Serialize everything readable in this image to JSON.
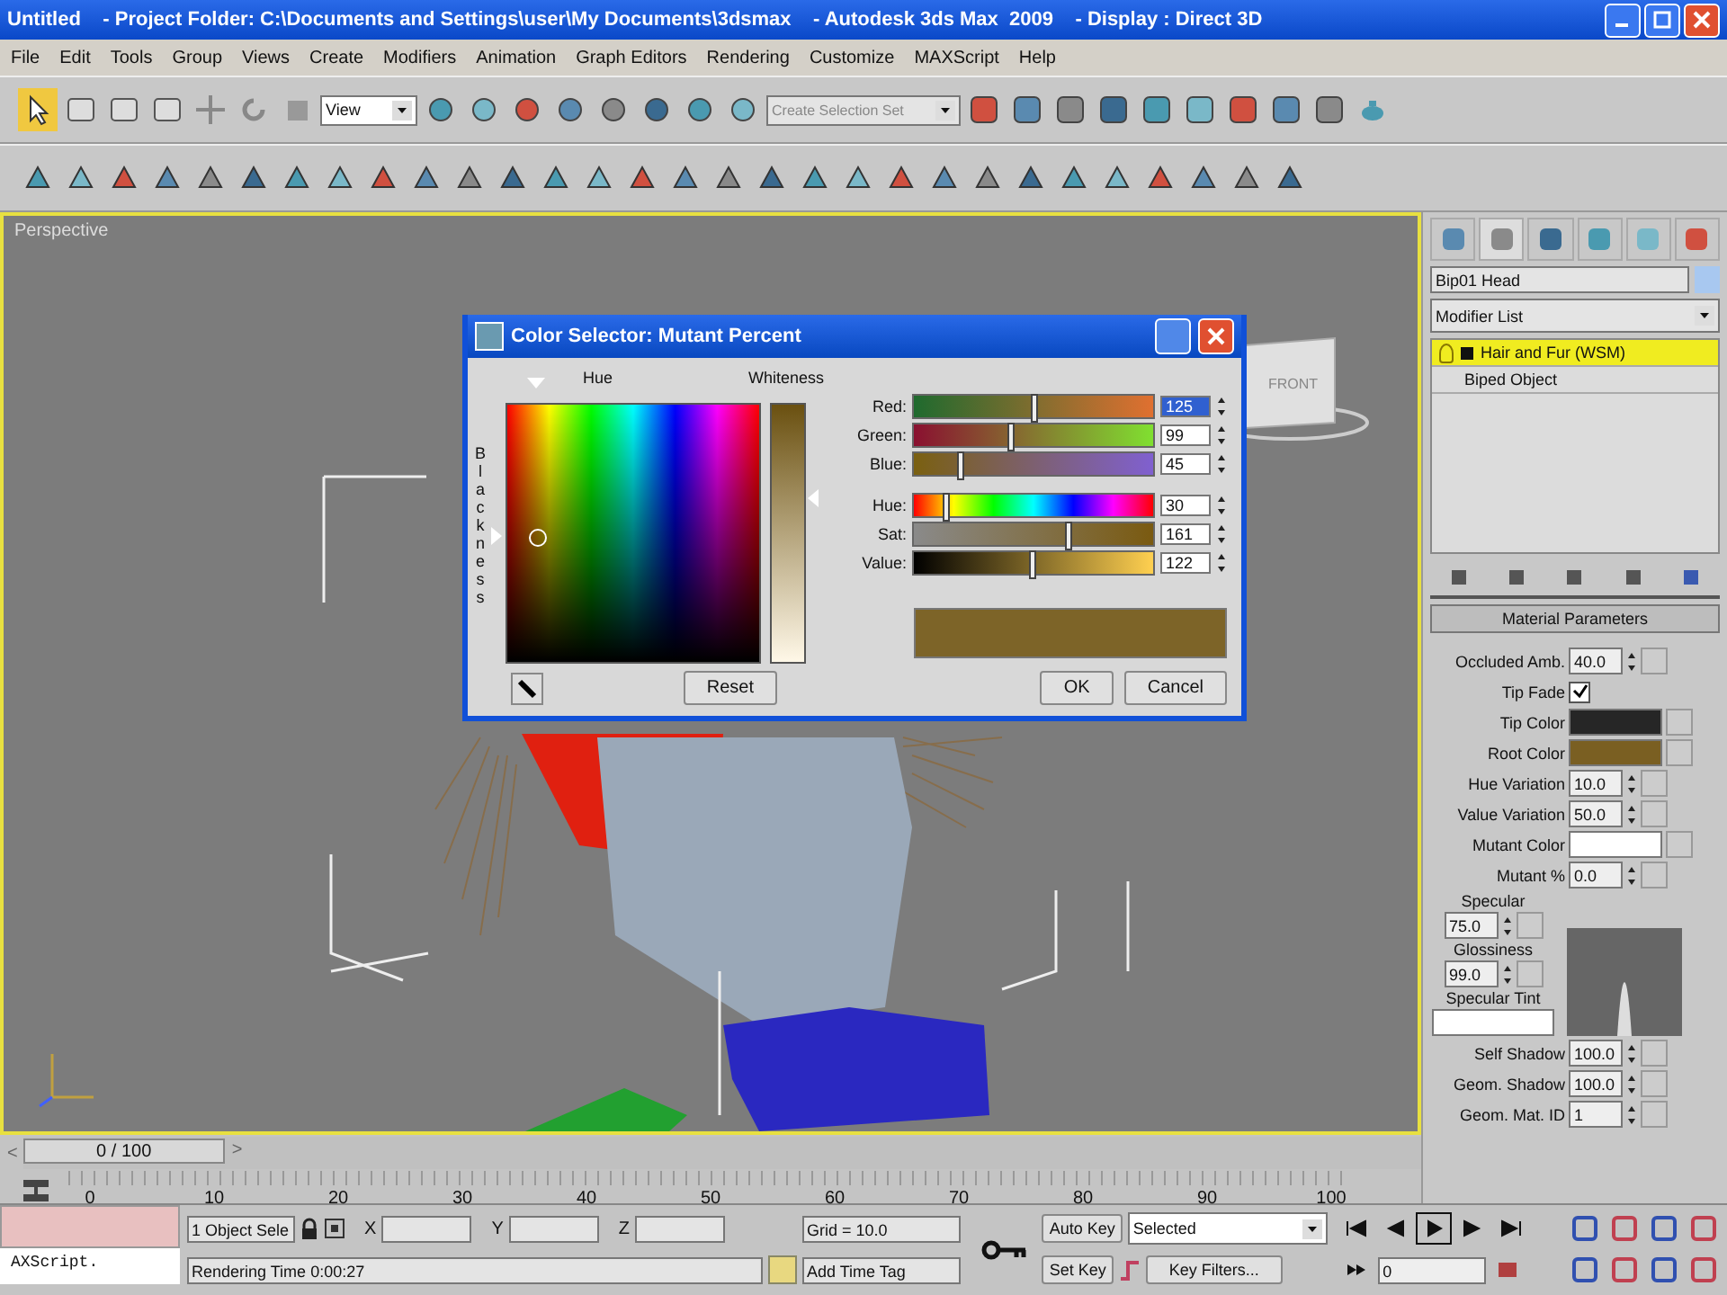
{
  "window": {
    "title": "Untitled    - Project Folder: C:\\Documents and Settings\\user\\My Documents\\3dsmax    - Autodesk 3ds Max  2009    - Display : Direct 3D"
  },
  "menu": [
    "File",
    "Edit",
    "Tools",
    "Group",
    "Views",
    "Create",
    "Modifiers",
    "Animation",
    "Graph Editors",
    "Rendering",
    "Customize",
    "MAXScript",
    "Help"
  ],
  "toolbar": {
    "reference_dropdown": "View",
    "selection_set_dropdown": "Create Selection Set"
  },
  "viewport": {
    "label": "Perspective",
    "viewcube_label": "FRONT"
  },
  "color_dialog": {
    "title": "Color Selector: Mutant Percent",
    "hue_label": "Hue",
    "whiteness_label": "Whiteness",
    "blackness_label": "Blackness",
    "sliders": [
      {
        "kind": "red",
        "label": "Red:",
        "value": "125",
        "level": 0.49,
        "highlighted": true
      },
      {
        "kind": "green",
        "label": "Green:",
        "value": "99",
        "level": 0.39,
        "highlighted": false
      },
      {
        "kind": "blue",
        "label": "Blue:",
        "value": "45",
        "level": 0.18,
        "highlighted": false
      },
      {
        "kind": "hue",
        "label": "Hue:",
        "value": "30",
        "level": 0.12,
        "highlighted": false
      },
      {
        "kind": "sat",
        "label": "Sat:",
        "value": "161",
        "level": 0.63,
        "highlighted": false
      },
      {
        "kind": "value",
        "label": "Value:",
        "value": "122",
        "level": 0.48,
        "highlighted": false
      }
    ],
    "buttons": {
      "reset": "Reset",
      "ok": "OK",
      "cancel": "Cancel"
    }
  },
  "command_panel": {
    "object_name": "Bip01 Head",
    "modifier_list": "Modifier List",
    "stack": [
      {
        "label": "Hair and Fur (WSM)",
        "selected": true
      },
      {
        "label": "Biped Object",
        "selected": false
      }
    ],
    "rollout_title": "Material Parameters",
    "params": [
      {
        "kind": "spinner",
        "label": "Occluded Amb.",
        "value": "40.0"
      },
      {
        "kind": "checkbox",
        "label": "Tip Fade",
        "checked": true
      },
      {
        "kind": "color",
        "label": "Tip Color",
        "color": "#262626"
      },
      {
        "kind": "color",
        "label": "Root Color",
        "color": "#7a5f22"
      },
      {
        "kind": "spinner",
        "label": "Hue Variation",
        "value": "10.0"
      },
      {
        "kind": "spinner",
        "label": "Value Variation",
        "value": "50.0"
      },
      {
        "kind": "color",
        "label": "Mutant Color",
        "color": "#ffffff"
      },
      {
        "kind": "spinner",
        "label": "Mutant %",
        "value": "0.0"
      }
    ],
    "specular": {
      "specular_label": "Specular",
      "specular_value": "75.0",
      "glossiness_label": "Glossiness",
      "glossiness_value": "99.0",
      "tint_label": "Specular Tint"
    },
    "params_after": [
      {
        "kind": "spinner",
        "label": "Self Shadow",
        "value": "100.0"
      },
      {
        "kind": "spinner",
        "label": "Geom. Shadow",
        "value": "100.0"
      },
      {
        "kind": "spinner",
        "label": "Geom. Mat. ID",
        "value": "1"
      }
    ]
  },
  "time_slider": {
    "label": "0 / 100",
    "level": 0,
    "prev": "<",
    "next": ">"
  },
  "ruler": {
    "labels": [
      "0",
      "10",
      "20",
      "30",
      "40",
      "50",
      "60",
      "70",
      "80",
      "90",
      "100"
    ]
  },
  "status": {
    "listener": "AXScript.",
    "selection": "1 Object Sele",
    "x_label": "X",
    "y_label": "Y",
    "z_label": "Z",
    "grid": "Grid = 10.0",
    "prompt": "Rendering Time  0:00:27",
    "time_tag": "Add Time Tag",
    "auto_key": "Auto Key",
    "key_mode": "Selected",
    "set_key": "Set Key",
    "key_filters": "Key Filters...",
    "frame": "0"
  }
}
